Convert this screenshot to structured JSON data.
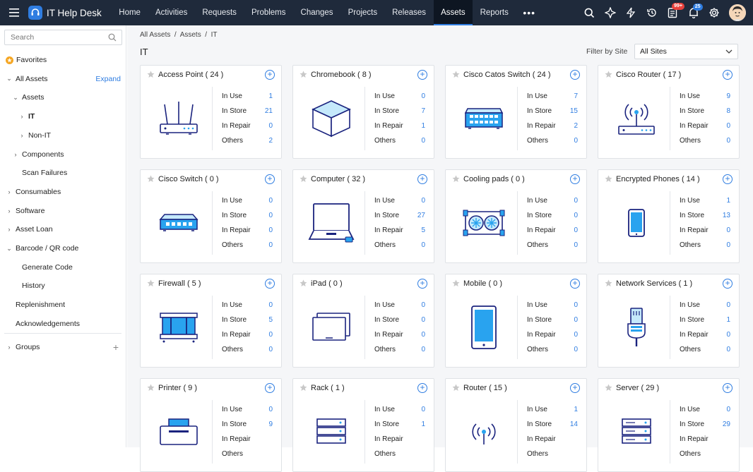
{
  "app": {
    "name": "IT Help Desk"
  },
  "nav": {
    "items": [
      "Home",
      "Activities",
      "Requests",
      "Problems",
      "Changes",
      "Projects",
      "Releases",
      "Assets",
      "Reports"
    ],
    "active_index": 7,
    "more_label": "•••"
  },
  "header_tools": {
    "notification_badge_1": "99+",
    "notification_badge_2": "25",
    "colors": {
      "badge_red": "#e8413c",
      "badge_blue": "#2f7de1"
    }
  },
  "sidebar": {
    "search_placeholder": "Search",
    "favorites": "Favorites",
    "all_assets": "All Assets",
    "expand": "Expand",
    "items": [
      {
        "label": "Assets"
      },
      {
        "label": "IT"
      },
      {
        "label": "Non-IT"
      },
      {
        "label": "Components"
      },
      {
        "label": "Scan Failures"
      },
      {
        "label": "Consumables"
      },
      {
        "label": "Software"
      },
      {
        "label": "Asset Loan"
      },
      {
        "label": "Barcode / QR code"
      },
      {
        "label": "Generate Code"
      },
      {
        "label": "History"
      },
      {
        "label": "Replenishment"
      },
      {
        "label": "Acknowledgements"
      },
      {
        "label": "Groups"
      }
    ]
  },
  "main": {
    "breadcrumb": "All Assets  /  Assets  /  IT",
    "title": "IT",
    "filter_label": "Filter by Site",
    "filter_value": "All Sites",
    "stat_labels": [
      "In Use",
      "In Store",
      "In Repair",
      "Others"
    ],
    "cards": [
      {
        "title": "Access Point ( 24 )",
        "icon": "access-point-icon",
        "stats": [
          "1",
          "21",
          "0",
          "2"
        ]
      },
      {
        "title": "Chromebook ( 8 )",
        "icon": "chromebook-icon",
        "stats": [
          "0",
          "7",
          "1",
          "0"
        ]
      },
      {
        "title": "Cisco Catos Switch ( 24 )",
        "icon": "cisco-catos-switch-icon",
        "stats": [
          "7",
          "15",
          "2",
          "0"
        ]
      },
      {
        "title": "Cisco Router ( 17 )",
        "icon": "cisco-router-icon",
        "stats": [
          "9",
          "8",
          "0",
          "0"
        ]
      },
      {
        "title": "Cisco Switch ( 0 )",
        "icon": "cisco-switch-icon",
        "stats": [
          "0",
          "0",
          "0",
          "0"
        ]
      },
      {
        "title": "Computer ( 32 )",
        "icon": "computer-icon",
        "stats": [
          "0",
          "27",
          "5",
          "0"
        ]
      },
      {
        "title": "Cooling pads ( 0 )",
        "icon": "cooling-pad-icon",
        "stats": [
          "0",
          "0",
          "0",
          "0"
        ]
      },
      {
        "title": "Encrypted Phones ( 14 )",
        "icon": "encrypted-phone-icon",
        "stats": [
          "1",
          "13",
          "0",
          "0"
        ]
      },
      {
        "title": "Firewall ( 5 )",
        "icon": "firewall-icon",
        "stats": [
          "0",
          "5",
          "0",
          "0"
        ]
      },
      {
        "title": "iPad ( 0 )",
        "icon": "ipad-icon",
        "stats": [
          "0",
          "0",
          "0",
          "0"
        ]
      },
      {
        "title": "Mobile ( 0 )",
        "icon": "mobile-icon",
        "stats": [
          "0",
          "0",
          "0",
          "0"
        ]
      },
      {
        "title": "Network Services ( 1 )",
        "icon": "network-services-icon",
        "stats": [
          "0",
          "1",
          "0",
          "0"
        ]
      },
      {
        "title": "Printer ( 9 )",
        "icon": "printer-icon",
        "stats": [
          "0",
          "9",
          "",
          ""
        ]
      },
      {
        "title": "Rack ( 1 )",
        "icon": "rack-icon",
        "stats": [
          "0",
          "1",
          "",
          ""
        ]
      },
      {
        "title": "Router ( 15 )",
        "icon": "router-icon",
        "stats": [
          "1",
          "14",
          "",
          ""
        ]
      },
      {
        "title": "Server ( 29 )",
        "icon": "server-icon",
        "stats": [
          "0",
          "29",
          "",
          ""
        ]
      }
    ]
  }
}
